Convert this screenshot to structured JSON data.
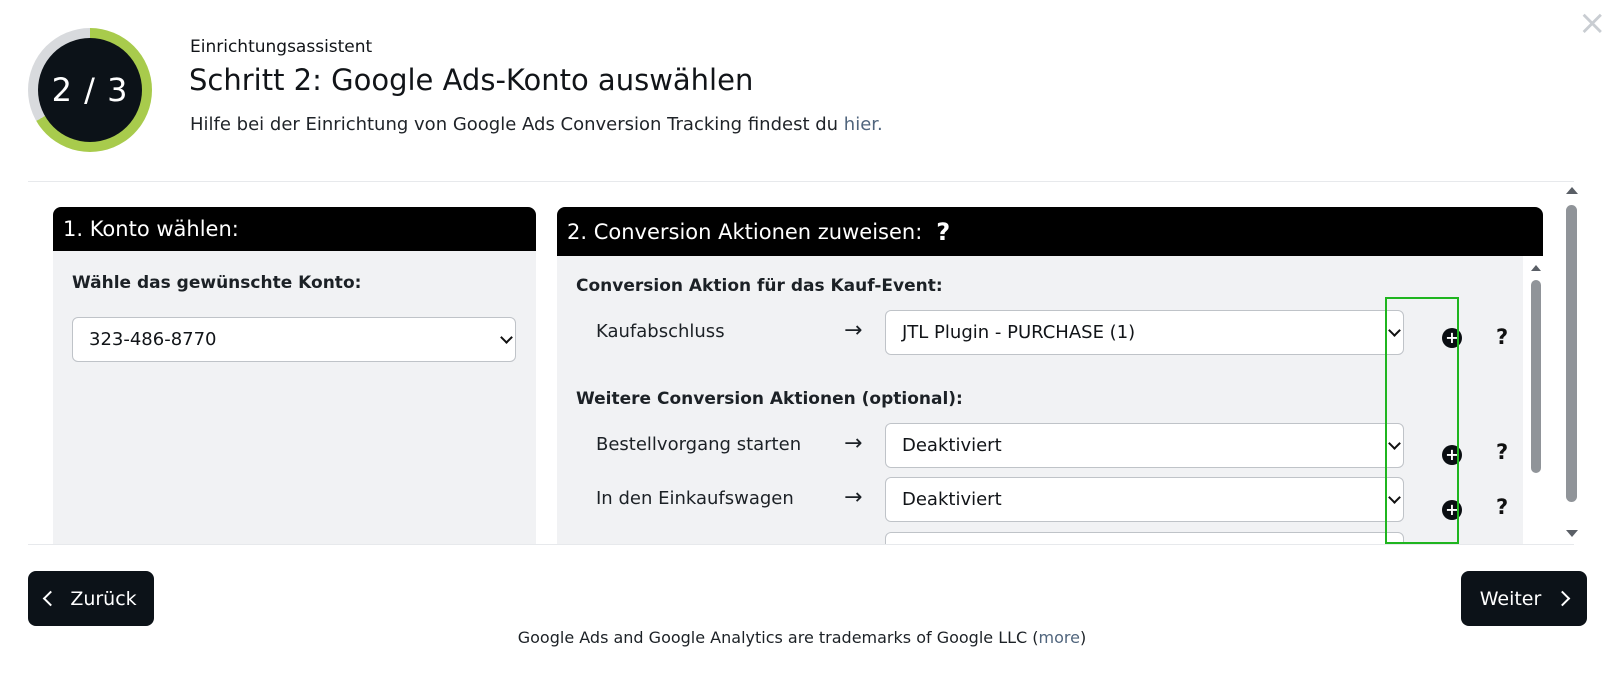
{
  "wizard": {
    "step_current": 2,
    "step_total": 3,
    "step_display": "2 / 3",
    "progress_fraction": 0.667,
    "eyebrow": "Einrichtungsassistent",
    "title": "Schritt 2: Google Ads-Konto auswählen",
    "subtitle_text": "Hilfe bei der Einrichtung von Google Ads Conversion Tracking findest du ",
    "subtitle_link": "hier."
  },
  "colors": {
    "progress_track": "#d8dadd",
    "progress_fill": "#a8cb4c",
    "dark": "#0c1218",
    "highlight": "#1fb51f"
  },
  "account_panel": {
    "title": "1. Konto wählen:",
    "label": "Wähle das gewünschte Konto:",
    "selected_account": "323-486-8770"
  },
  "conversion_panel": {
    "title": "2. Conversion Aktionen zuweisen:",
    "help_icon_label": "?",
    "purchase_section_label": "Conversion Aktion für das Kauf-Event:",
    "purchase_row": {
      "label": "Kaufabschluss",
      "selected": "JTL Plugin - PURCHASE (1)"
    },
    "optional_section_label": "Weitere Conversion Aktionen (optional):",
    "optional_rows": [
      {
        "label": "Bestellvorgang starten",
        "selected": "Deaktiviert"
      },
      {
        "label": "In den Einkaufswagen",
        "selected": "Deaktiviert"
      }
    ],
    "arrow_glyph": "→",
    "row_help_label": "?"
  },
  "navigation": {
    "back_label": "Zurück",
    "next_label": "Weiter"
  },
  "footer": {
    "text": "Google Ads and Google Analytics are trademarks of Google LLC (",
    "link": "more",
    "text_end": ")"
  },
  "icons": {
    "close": "close-icon",
    "plus": "plus-circle-icon",
    "help": "question-mark-icon",
    "back": "chevron-left-icon",
    "next": "chevron-right-icon",
    "arrow": "arrow-right-icon",
    "dropdown": "chevron-down-icon"
  }
}
